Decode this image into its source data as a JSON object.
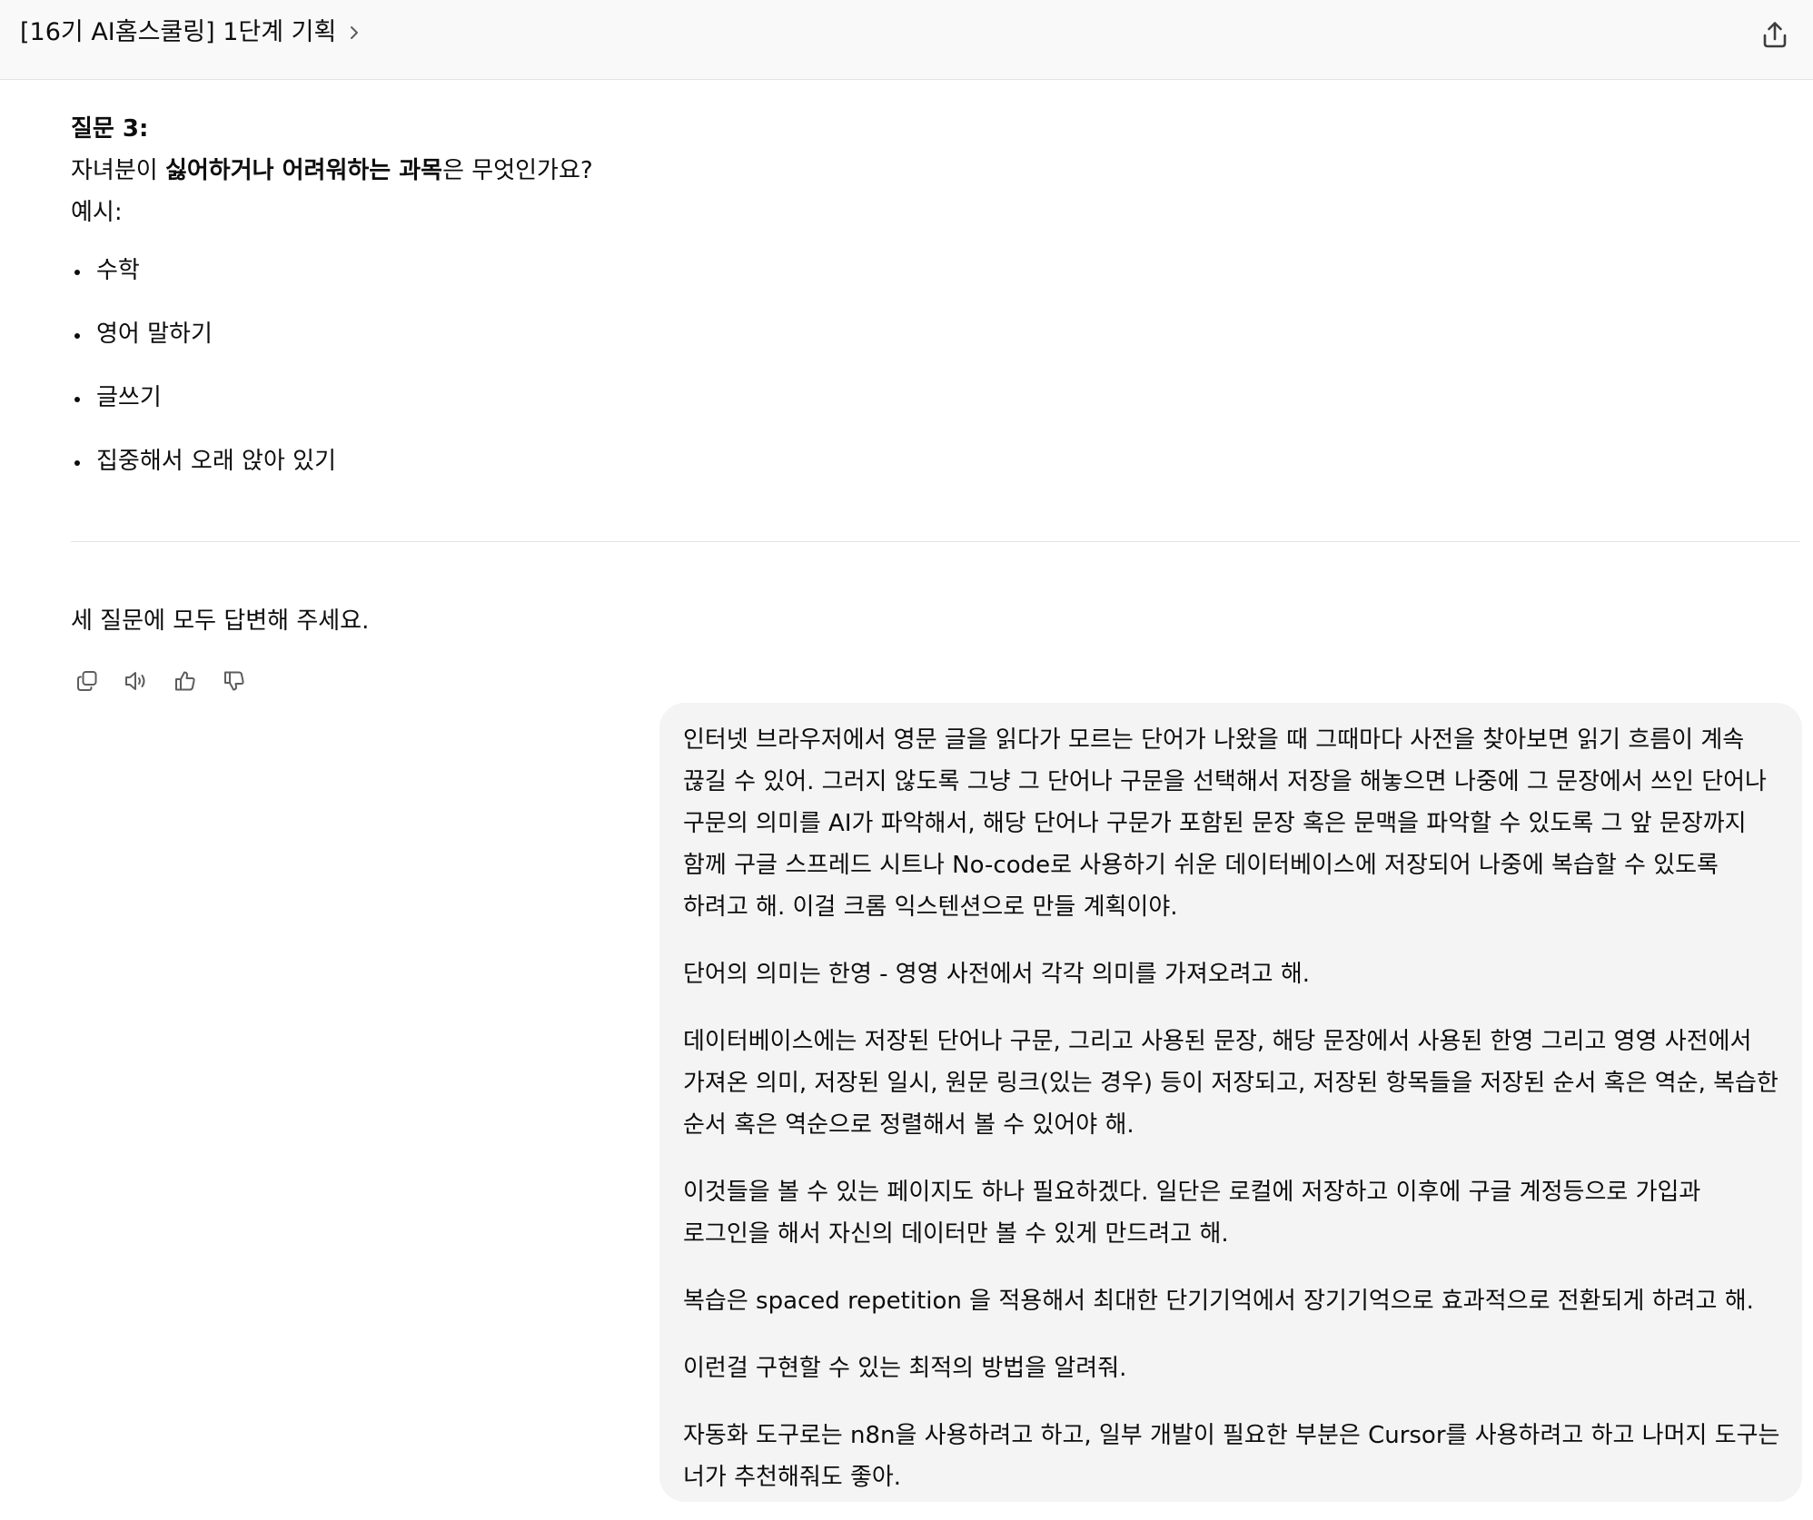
{
  "header": {
    "title": "[16기 AI홈스쿨링] 1단계 기획",
    "share_icon": "share-icon",
    "chevron_icon": "chevron-right-icon"
  },
  "assistant": {
    "question_title": "질문 3:",
    "question_prefix": "자녀분이 ",
    "question_bold": "싫어하거나 어려워하는 과목",
    "question_suffix": "은 무엇인가요?",
    "example_label": "예시:",
    "bullets": [
      "수학",
      "영어 말하기",
      "글쓰기",
      "집중해서 오래 앉아 있기"
    ],
    "closing": "세 질문에 모두 답변해 주세요.",
    "actions": {
      "copy": "copy-icon",
      "read_aloud": "speaker-icon",
      "thumbs_up": "thumbs-up-icon",
      "thumbs_down": "thumbs-down-icon"
    }
  },
  "user_message": {
    "paragraphs": [
      "인터넷 브라우저에서 영문 글을 읽다가 모르는 단어가 나왔을 때 그때마다 사전을 찾아보면 읽기 흐름이 계속 끊길 수 있어. 그러지 않도록 그냥 그 단어나 구문을 선택해서 저장을 해놓으면 나중에 그 문장에서 쓰인 단어나 구문의 의미를 AI가 파악해서, 해당 단어나 구문가 포함된 문장 혹은 문맥을 파악할 수 있도록 그 앞 문장까지 함께 구글 스프레드 시트나 No-code로 사용하기 쉬운 데이터베이스에 저장되어 나중에 복습할 수 있도록 하려고 해. 이걸 크롬 익스텐션으로 만들 계획이야.",
      "단어의 의미는 한영 - 영영 사전에서 각각 의미를 가져오려고 해.",
      "데이터베이스에는 저장된 단어나 구문, 그리고 사용된 문장, 해당 문장에서 사용된 한영 그리고 영영 사전에서 가져온 의미, 저장된 일시, 원문 링크(있는 경우) 등이 저장되고, 저장된 항목들을 저장된 순서 혹은 역순, 복습한 순서 혹은 역순으로 정렬해서 볼 수 있어야 해.",
      "이것들을 볼 수 있는 페이지도 하나 필요하겠다. 일단은 로컬에 저장하고 이후에 구글 계정등으로 가입과 로그인을 해서 자신의 데이터만 볼 수 있게 만드려고 해.",
      "복습은 spaced repetition 을 적용해서 최대한 단기기억에서 장기기억으로 효과적으로 전환되게 하려고 해.",
      "이런걸 구현할 수 있는 최적의 방법을 알려줘.",
      "자동화 도구로는 n8n을 사용하려고 하고, 일부 개발이 필요한 부분은 Cursor를 사용하려고 하고 나머지 도구는 너가 추천해줘도 좋아."
    ]
  }
}
